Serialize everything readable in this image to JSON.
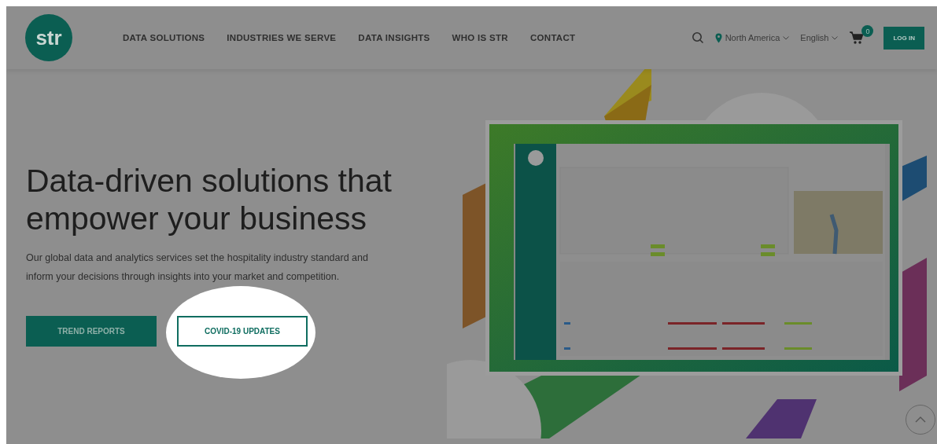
{
  "header": {
    "logo": "str",
    "nav": [
      "DATA SOLUTIONS",
      "INDUSTRIES WE SERVE",
      "DATA INSIGHTS",
      "WHO IS STR",
      "CONTACT"
    ],
    "region": "North America",
    "language": "English",
    "cart_count": "0",
    "login": "LOG IN"
  },
  "hero": {
    "headline": "Data-driven solutions that empower your business",
    "description": "Our global data and analytics services set the hospitality industry standard and inform your decisions through insights into your market and competition.",
    "buttons": [
      {
        "label": "TREND REPORTS",
        "kind": "filled",
        "highlighted": false
      },
      {
        "label": "COVID-19 UPDATES",
        "kind": "outline",
        "highlighted": true
      }
    ]
  }
}
